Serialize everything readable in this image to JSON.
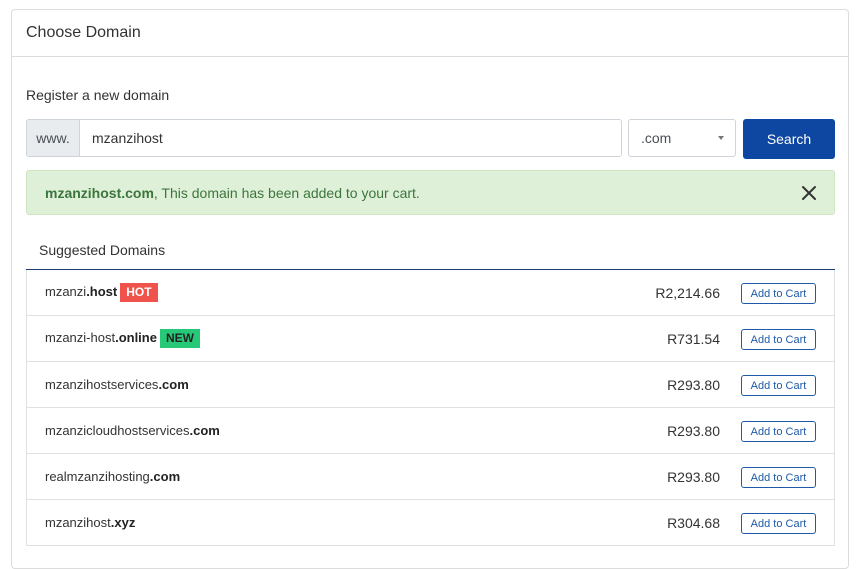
{
  "panel": {
    "title": "Choose Domain"
  },
  "register": {
    "label": "Register a new domain",
    "prefix": "www.",
    "domain_value": "mzanzihost",
    "tld_selected": ".com",
    "search_label": "Search"
  },
  "alert": {
    "domain": "mzanzihost.com",
    "message": ", This domain has been added to your cart."
  },
  "suggested": {
    "title": "Suggested Domains",
    "items": [
      {
        "sld": "mzanzi",
        "tld": ".host",
        "badge": "HOT",
        "price": "R2,214.66",
        "button": "Add to Cart"
      },
      {
        "sld": "mzanzi-host",
        "tld": ".online",
        "badge": "NEW",
        "price": "R731.54",
        "button": "Add to Cart"
      },
      {
        "sld": "mzanzihostservices",
        "tld": ".com",
        "badge": "",
        "price": "R293.80",
        "button": "Add to Cart"
      },
      {
        "sld": "mzanzicloudhostservices",
        "tld": ".com",
        "badge": "",
        "price": "R293.80",
        "button": "Add to Cart"
      },
      {
        "sld": "realmzanzihosting",
        "tld": ".com",
        "badge": "",
        "price": "R293.80",
        "button": "Add to Cart"
      },
      {
        "sld": "mzanzihost",
        "tld": ".xyz",
        "badge": "",
        "price": "R304.68",
        "button": "Add to Cart"
      }
    ]
  },
  "colors": {
    "primary": "#0d47a1",
    "alert_bg": "#dff0d8",
    "alert_text": "#3c763d",
    "hot": "#f0534c",
    "new": "#27c878"
  },
  "icons": {
    "close": "close-icon",
    "dropdown": "chevron-down-icon"
  }
}
